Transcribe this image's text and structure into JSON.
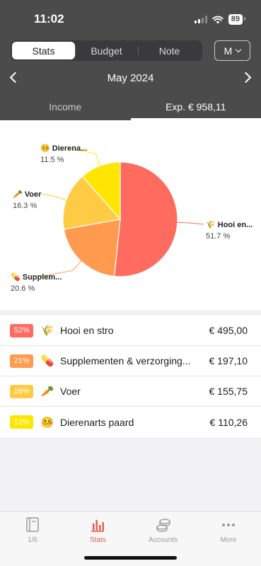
{
  "status_bar": {
    "time": "11:02",
    "battery": "89"
  },
  "mode_tabs": [
    {
      "label": "Stats",
      "active": true
    },
    {
      "label": "Budget",
      "active": false
    },
    {
      "label": "Note",
      "active": false
    }
  ],
  "period_select": {
    "value": "M"
  },
  "month_nav": {
    "label": "May 2024"
  },
  "type_tabs": {
    "income": "Income",
    "expense": "Exp. € 958,11"
  },
  "chart_data": {
    "type": "pie",
    "slices": [
      {
        "emoji": "🌾",
        "label": "Hooi en...",
        "value": 51.7,
        "pct_label": "51.7 %",
        "color": "#ff6b5f"
      },
      {
        "emoji": "💊",
        "label": "Supplem...",
        "value": 20.6,
        "pct_label": "20.6 %",
        "color": "#ff9a4f"
      },
      {
        "emoji": "🥕",
        "label": "Voer",
        "value": 16.3,
        "pct_label": "16.3 %",
        "color": "#ffcb45"
      },
      {
        "emoji": "🤒",
        "label": "Dierena...",
        "value": 11.5,
        "pct_label": "11.5 %",
        "color": "#ffe600"
      }
    ]
  },
  "categories": [
    {
      "percent": "52%",
      "emoji": "🌾",
      "name": "Hooi en stro",
      "amount": "€ 495,00",
      "color": "#ff6b5f"
    },
    {
      "percent": "21%",
      "emoji": "💊",
      "name": "Supplementen & verzorging...",
      "amount": "€ 197,10",
      "color": "#ff9a4f"
    },
    {
      "percent": "16%",
      "emoji": "🥕",
      "name": "Voer",
      "amount": "€ 155,75",
      "color": "#ffcb45"
    },
    {
      "percent": "12%",
      "emoji": "🤒",
      "name": "Dierenarts paard",
      "amount": "€ 110,26",
      "color": "#ffe600"
    }
  ],
  "tabbar": [
    {
      "label": "1/6",
      "icon": "book-icon",
      "active": false
    },
    {
      "label": "Stats",
      "icon": "bar-chart-icon",
      "active": true
    },
    {
      "label": "Accounts",
      "icon": "coins-icon",
      "active": false
    },
    {
      "label": "More",
      "icon": "more-dots-icon",
      "active": false
    }
  ]
}
